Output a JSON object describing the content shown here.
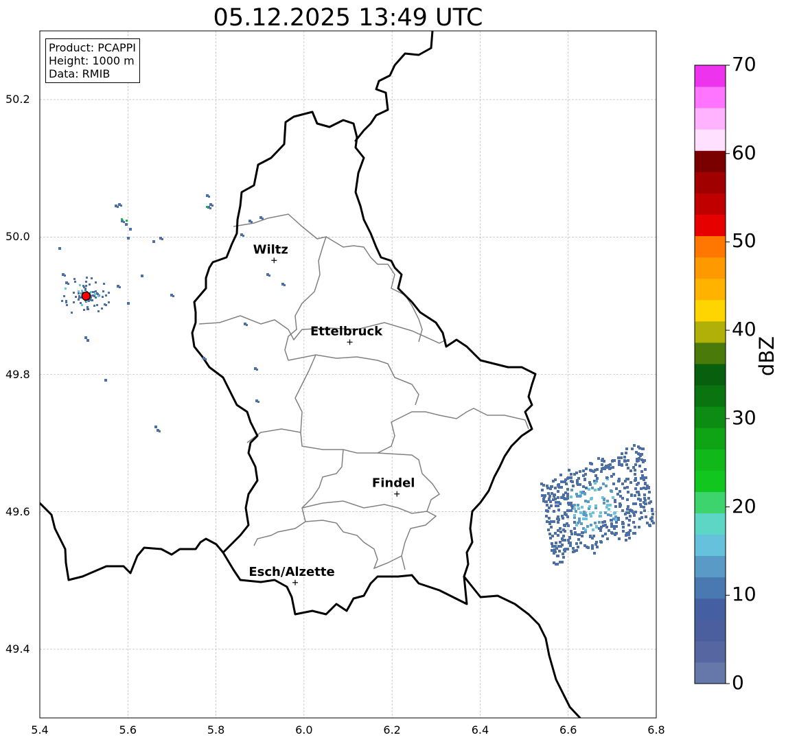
{
  "title": "05.12.2025 13:49 UTC",
  "info": {
    "product": "Product: PCAPPI",
    "height": "Height: 1000 m",
    "data": "Data: RMIB"
  },
  "axes": {
    "x_ticks": [
      "5.4",
      "5.6",
      "5.8",
      "6.0",
      "6.2",
      "6.4",
      "6.6",
      "6.8"
    ],
    "y_ticks": [
      "50.2",
      "50.0",
      "49.8",
      "49.6",
      "49.4"
    ],
    "lon_range": [
      5.4,
      6.8
    ],
    "lat_range": [
      49.3,
      50.3
    ],
    "grid": true
  },
  "radar_site": {
    "lon": 5.505,
    "lat": 49.914,
    "color": "#ff0000"
  },
  "cities": [
    {
      "name": "Wiltz",
      "lon": 5.932,
      "lat": 49.966
    },
    {
      "name": "Ettelbruck",
      "lon": 6.104,
      "lat": 49.847
    },
    {
      "name": "Findel",
      "lon": 6.211,
      "lat": 49.626
    },
    {
      "name": "Esch/Alzette",
      "lon": 5.98,
      "lat": 49.497
    }
  ],
  "colorbar": {
    "label": "dBZ",
    "ticks": [
      "0",
      "10",
      "20",
      "30",
      "40",
      "50",
      "60",
      "70"
    ],
    "min": 0,
    "max": 70,
    "step": 2.5,
    "colors": [
      "#6677aa",
      "#5566a0",
      "#4b5f9e",
      "#4460a2",
      "#4a78b0",
      "#5a9ac6",
      "#66c2dc",
      "#5ed6c6",
      "#3dd46e",
      "#11c61f",
      "#10b81a",
      "#0ea416",
      "#0c8c12",
      "#0a7510",
      "#085f0e",
      "#4a7a0a",
      "#b0b008",
      "#ffd500",
      "#ffb300",
      "#ff9900",
      "#ff7700",
      "#e60000",
      "#c00000",
      "#a00000",
      "#7a0000",
      "#ffe0ff",
      "#ffb3ff",
      "#ff75ff",
      "#ee33ee"
    ]
  },
  "map_colors": {
    "border": "#000000",
    "cantons": "#808080",
    "echo_light": "#4d6fa8",
    "echo_mid": "#5c9ac6",
    "echo_bright": "#69c4dc",
    "echo_green": "#16b84a"
  }
}
